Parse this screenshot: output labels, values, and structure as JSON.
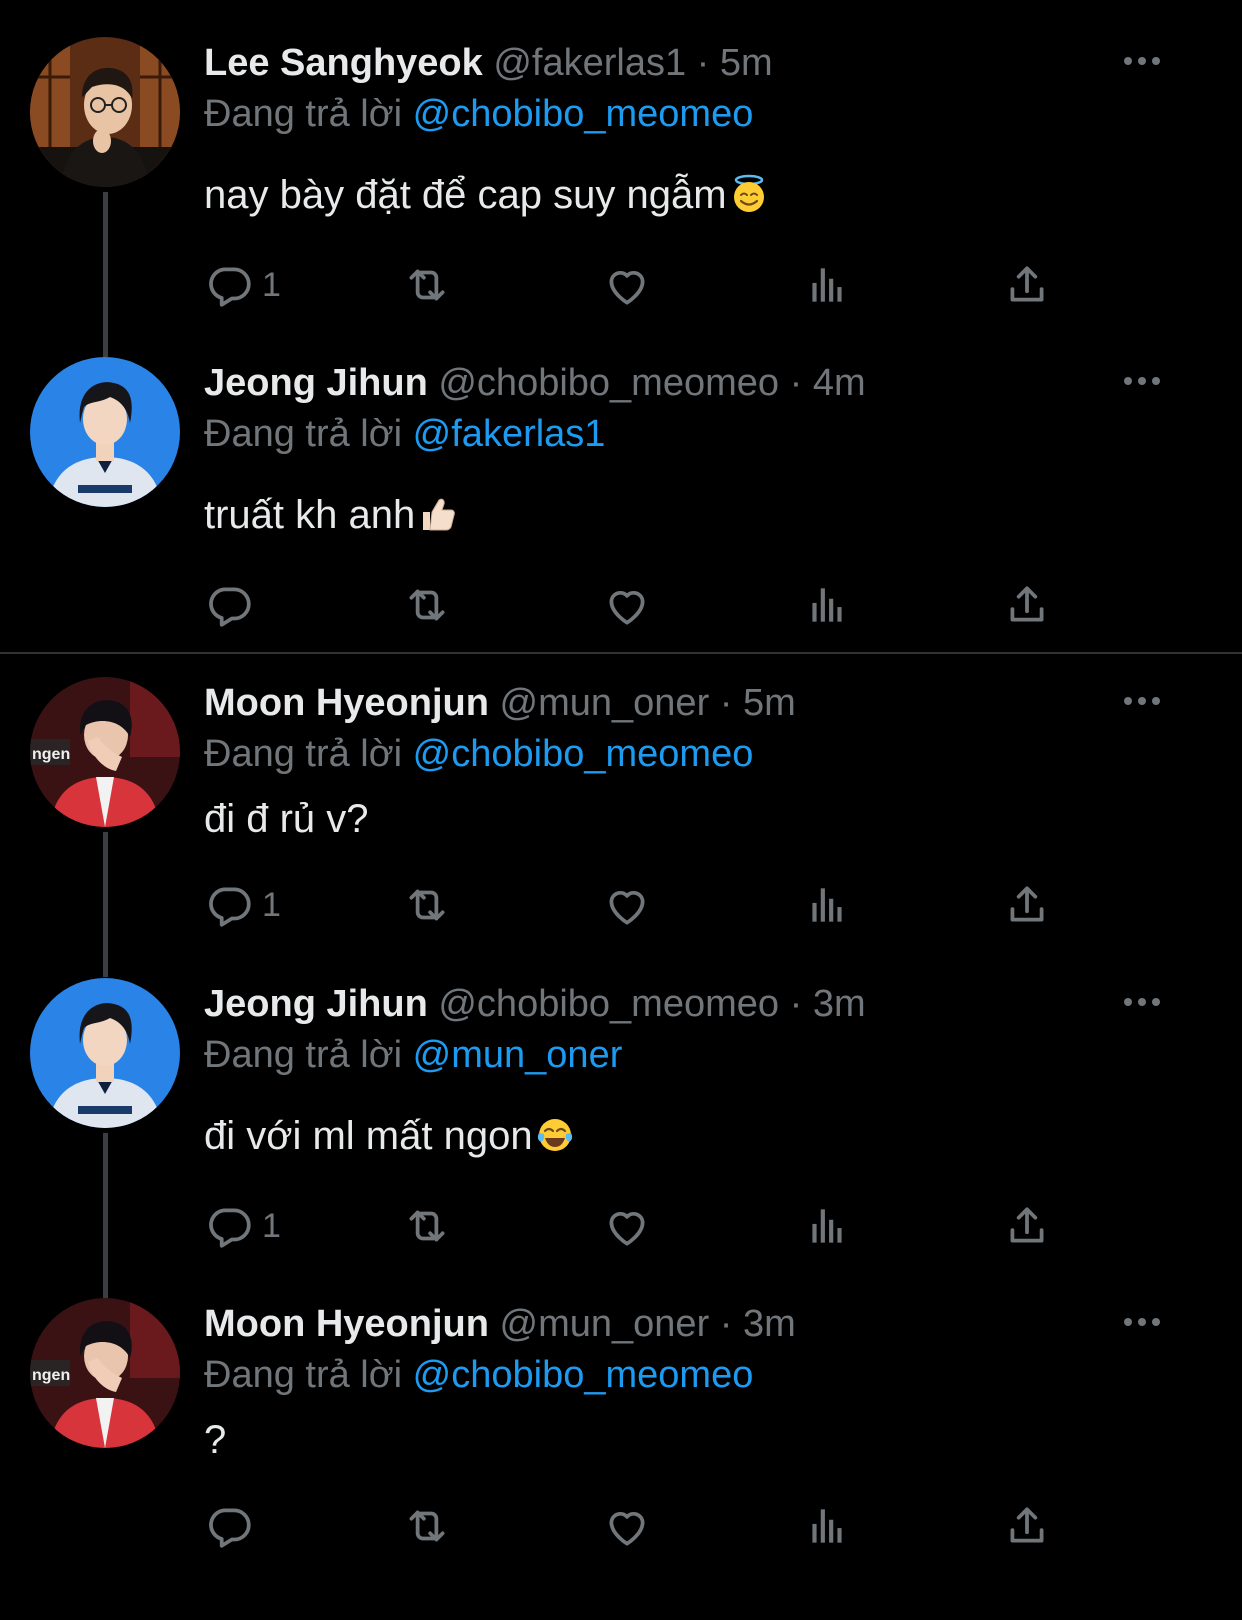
{
  "reply_prefix": "Đang trả lời",
  "colors": {
    "background": "#000000",
    "mention": "#1d9bf0",
    "muted": "#71767b",
    "thread_line": "#3a3d41"
  },
  "tweets": [
    {
      "name": "Lee Sanghyeok",
      "handle": "@fakerlas1",
      "separator": "·",
      "time": "5m",
      "replying_to": "@chobibo_meomeo",
      "text": "nay bày đặt để cap suy ngẫm",
      "emoji": "smiling-face-with-halo",
      "reply_count": "1",
      "avatar": "avatar-lee"
    },
    {
      "name": "Jeong Jihun",
      "handle": "@chobibo_meomeo",
      "separator": "·",
      "time": "4m",
      "replying_to": "@fakerlas1",
      "text": "truất kh anh",
      "emoji": "thumbs-up",
      "reply_count": "",
      "avatar": "avatar-jeong"
    },
    {
      "name": "Moon Hyeonjun",
      "handle": "@mun_oner",
      "separator": "·",
      "time": "5m",
      "replying_to": "@chobibo_meomeo",
      "text": "đi đ rủ v?",
      "emoji": "",
      "reply_count": "1",
      "avatar": "avatar-moon",
      "avatar_text": "ngen"
    },
    {
      "name": "Jeong Jihun",
      "handle": "@chobibo_meomeo",
      "separator": "·",
      "time": "3m",
      "replying_to": "@mun_oner",
      "text": "đi với ml mất ngon",
      "emoji": "face-with-tears-of-joy",
      "reply_count": "1",
      "avatar": "avatar-jeong"
    },
    {
      "name": "Moon Hyeonjun",
      "handle": "@mun_oner",
      "separator": "·",
      "time": "3m",
      "replying_to": "@chobibo_meomeo",
      "text": "?",
      "emoji": "",
      "reply_count": "",
      "avatar": "avatar-moon",
      "avatar_text": "ngen"
    }
  ],
  "icons": [
    "reply-icon",
    "retweet-icon",
    "like-icon",
    "views-icon",
    "share-icon",
    "more-options-icon"
  ]
}
